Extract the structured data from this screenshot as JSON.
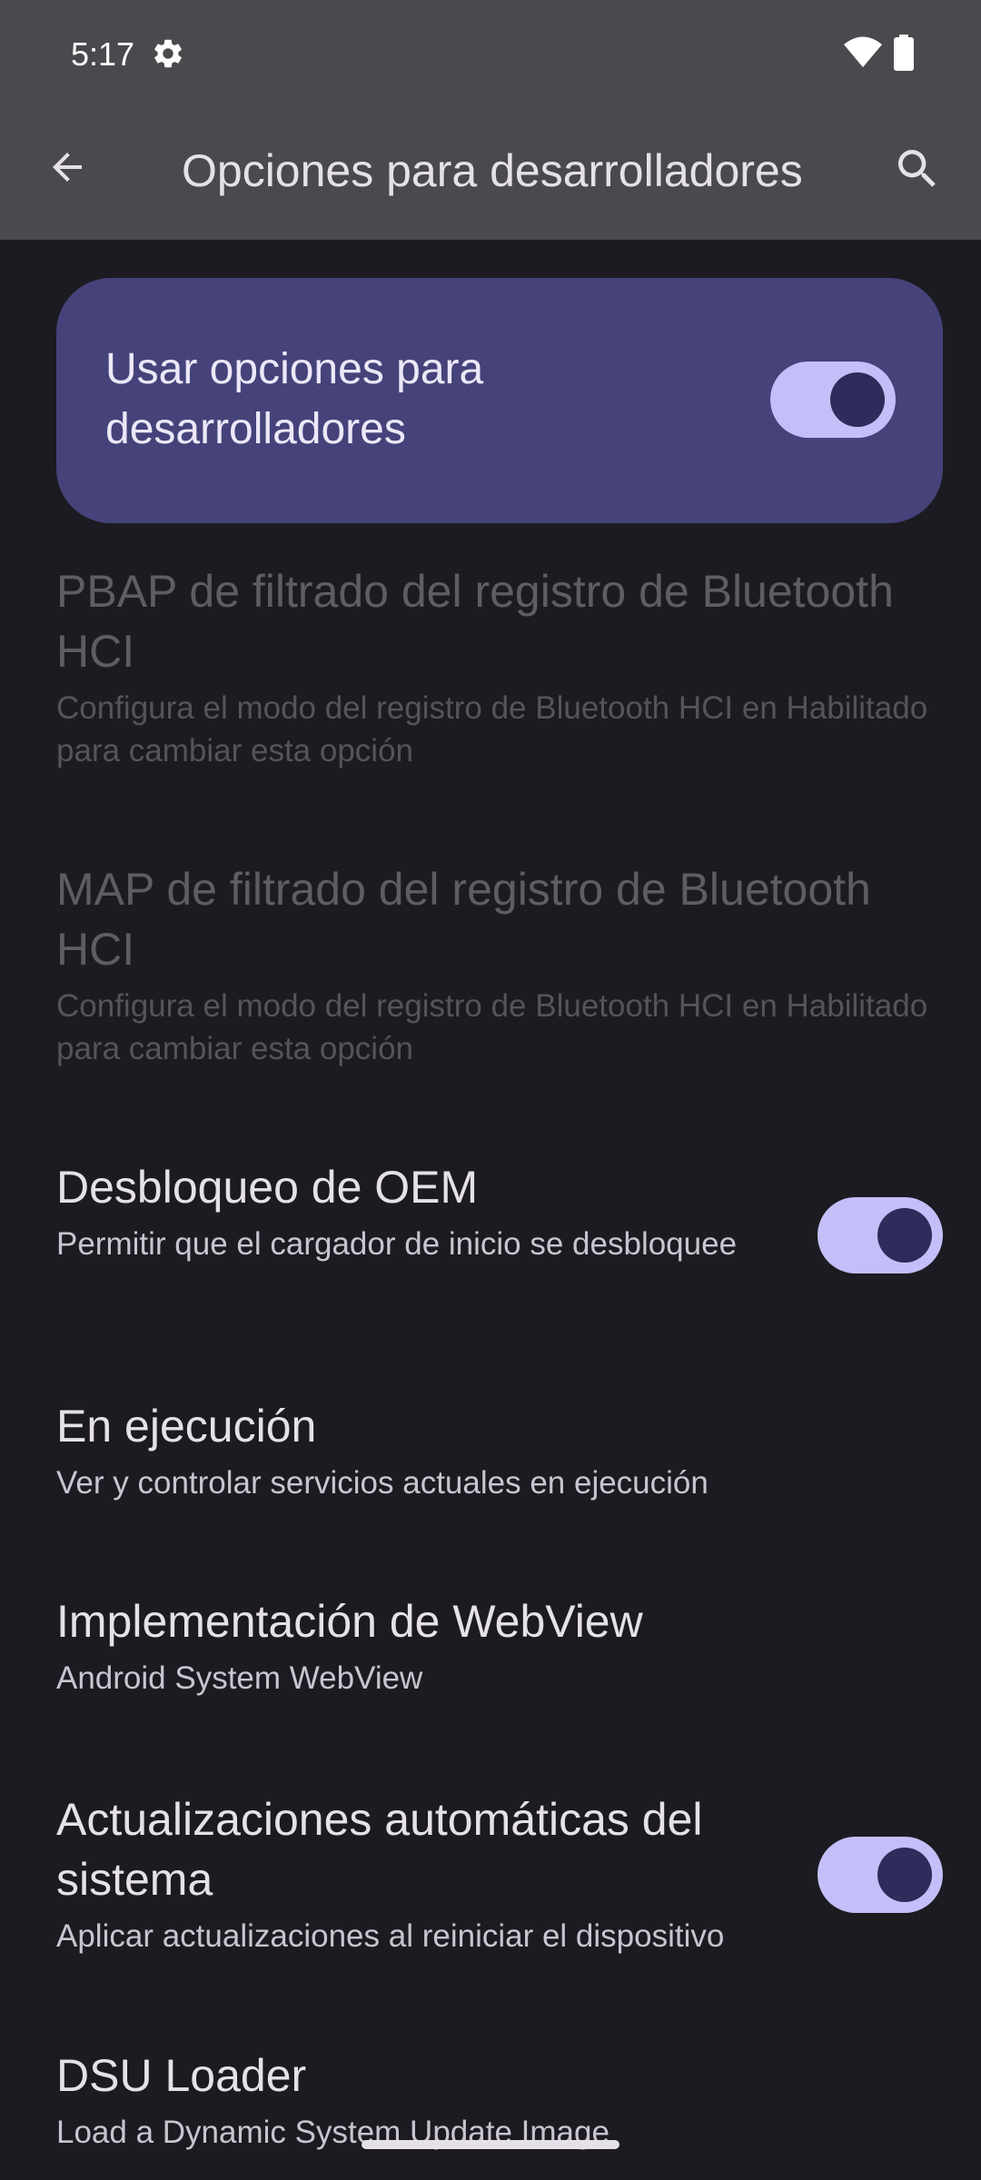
{
  "status_bar": {
    "time": "5:17"
  },
  "app_bar": {
    "title": "Opciones para desarrolladores"
  },
  "main_toggle": {
    "label": "Usar opciones para desarrolladores",
    "checked": true
  },
  "preferences": [
    {
      "title": "PBAP de filtrado del registro de Bluetooth HCI",
      "summary": "Configura el modo del registro de Bluetooth HCI en Habilitado para cambiar esta opción",
      "enabled": false
    },
    {
      "title": "MAP de filtrado del registro de Bluetooth HCI",
      "summary": "Configura el modo del registro de Bluetooth HCI en Habilitado para cambiar esta opción",
      "enabled": false
    },
    {
      "title": "Desbloqueo de OEM",
      "summary": "Permitir que el cargador de inicio se desbloquee",
      "enabled": true,
      "switch_on": true
    },
    {
      "title": "En ejecución",
      "summary": "Ver y controlar servicios actuales en ejecución",
      "enabled": true
    },
    {
      "title": "Implementación de WebView",
      "summary": "Android System WebView",
      "enabled": true
    },
    {
      "title": "Actualizaciones automáticas del sistema",
      "summary": "Aplicar actualizaciones al reiniciar el dispositivo",
      "enabled": true,
      "switch_on": true
    },
    {
      "title": "DSU Loader",
      "summary": "Load a Dynamic System Update Image",
      "enabled": true
    }
  ],
  "colors": {
    "background": "#1c1b21",
    "top_bar": "#4a494e",
    "card": "#45437a",
    "switch_track": "#c4bff8",
    "switch_thumb": "#2e2c5a"
  },
  "icons": {
    "status_settings": "gear-icon",
    "status_wifi": "wifi-icon",
    "status_battery": "battery-icon",
    "navigate_up": "arrow-back-icon",
    "search": "search-icon"
  }
}
